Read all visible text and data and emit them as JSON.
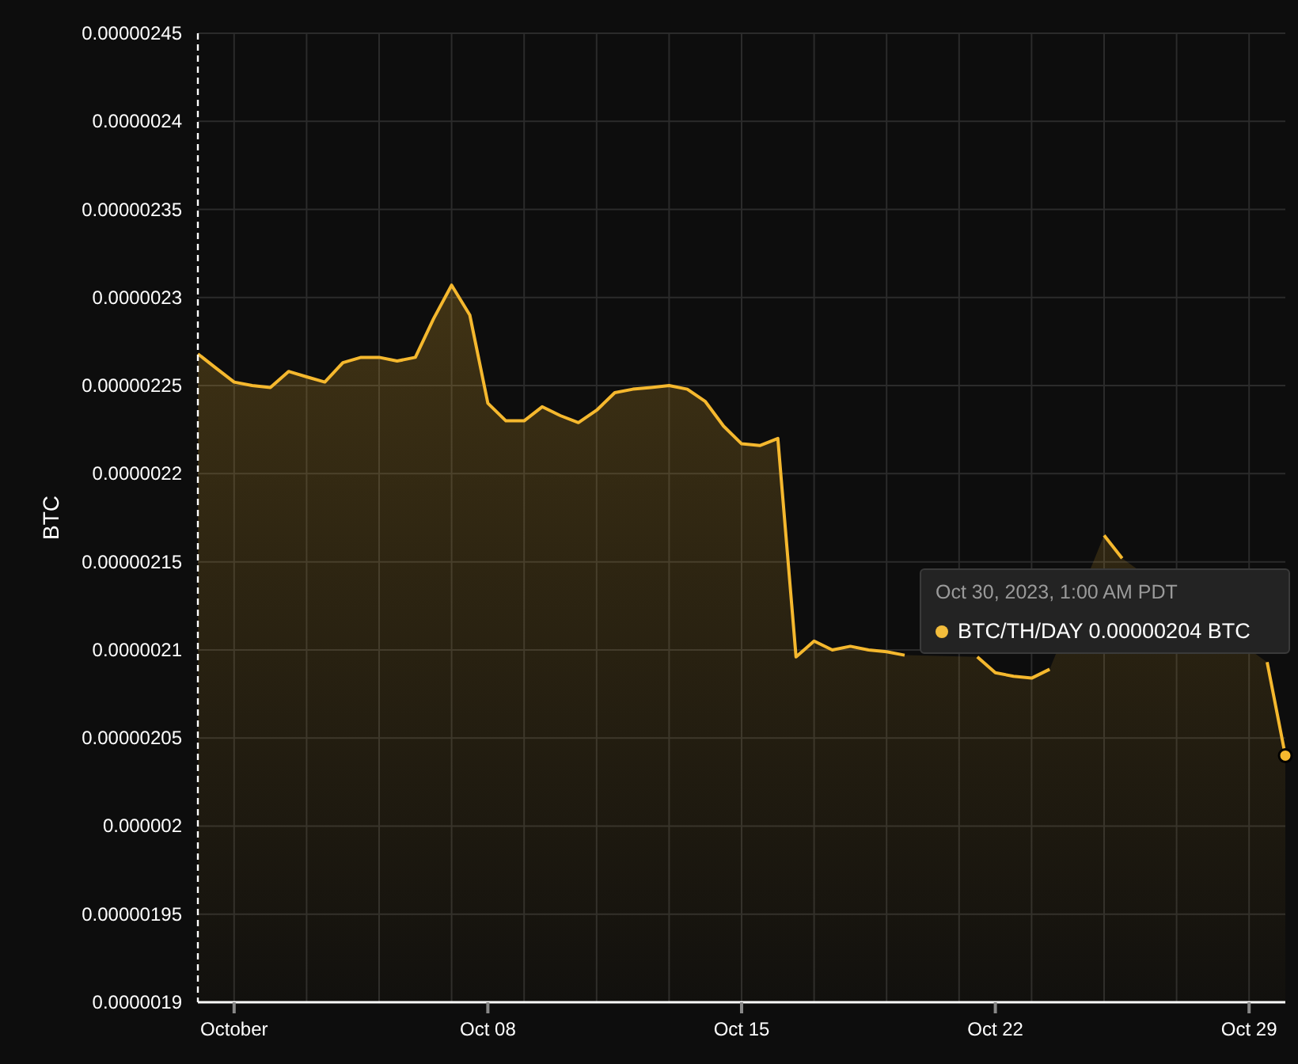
{
  "chart": {
    "chart_data": {
      "type": "area",
      "ylabel": "BTC",
      "categories": [
        null,
        null,
        "October",
        null,
        null,
        null,
        null,
        null,
        null,
        null,
        null,
        null,
        null,
        null,
        null,
        null,
        "Oct 08",
        null,
        null,
        null,
        null,
        null,
        null,
        null,
        null,
        null,
        null,
        null,
        null,
        null,
        "Oct 15",
        null,
        null,
        null,
        null,
        null,
        null,
        null,
        null,
        null,
        null,
        null,
        null,
        null,
        "Oct 22",
        null,
        null,
        null,
        null,
        null,
        null,
        null,
        null,
        null,
        null,
        null,
        null,
        null,
        "Oct 29",
        null,
        null
      ],
      "series": [
        {
          "name": "BTC/TH/DAY",
          "color": "#f5b82e",
          "values": [
            2.268e-06,
            2.26e-06,
            2.252e-06,
            2.25e-06,
            2.249e-06,
            2.258e-06,
            2.255e-06,
            2.252e-06,
            2.263e-06,
            2.266e-06,
            2.266e-06,
            2.264e-06,
            2.266e-06,
            2.288e-06,
            2.307e-06,
            2.29e-06,
            2.24e-06,
            2.23e-06,
            2.23e-06,
            2.238e-06,
            2.233e-06,
            2.229e-06,
            2.236e-06,
            2.246e-06,
            2.248e-06,
            2.249e-06,
            2.25e-06,
            2.248e-06,
            2.241e-06,
            2.227e-06,
            2.217e-06,
            2.216e-06,
            2.22e-06,
            2.096e-06,
            2.105e-06,
            2.1e-06,
            2.102e-06,
            2.1e-06,
            2.099e-06,
            2.097e-06,
            null,
            null,
            null,
            2.096e-06,
            2.087e-06,
            2.085e-06,
            2.084e-06,
            2.089e-06,
            null,
            null,
            2.165e-06,
            2.152e-06,
            null,
            null,
            null,
            null,
            null,
            null,
            null,
            2.093e-06,
            2.04e-06
          ]
        }
      ],
      "grid": true,
      "ylim": [
        1.9e-06,
        2.45e-06
      ],
      "yticks": [
        {
          "value": 1.9e-06,
          "label": "0.0000019"
        },
        {
          "value": 1.95e-06,
          "label": "0.00000195"
        },
        {
          "value": 2e-06,
          "label": "0.000002"
        },
        {
          "value": 2.05e-06,
          "label": "0.00000205"
        },
        {
          "value": 2.1e-06,
          "label": "0.0000021"
        },
        {
          "value": 2.15e-06,
          "label": "0.00000215"
        },
        {
          "value": 2.2e-06,
          "label": "0.0000022"
        },
        {
          "value": 2.25e-06,
          "label": "0.00000225"
        },
        {
          "value": 2.3e-06,
          "label": "0.0000023"
        },
        {
          "value": 2.35e-06,
          "label": "0.00000235"
        },
        {
          "value": 2.4e-06,
          "label": "0.0000024"
        },
        {
          "value": 2.45e-06,
          "label": "0.00000245"
        }
      ]
    },
    "tooltip": {
      "title": "Oct 30, 2023, 1:00 AM PDT",
      "value": "0.00000204 BTC",
      "color": "#f3bd3c"
    }
  }
}
